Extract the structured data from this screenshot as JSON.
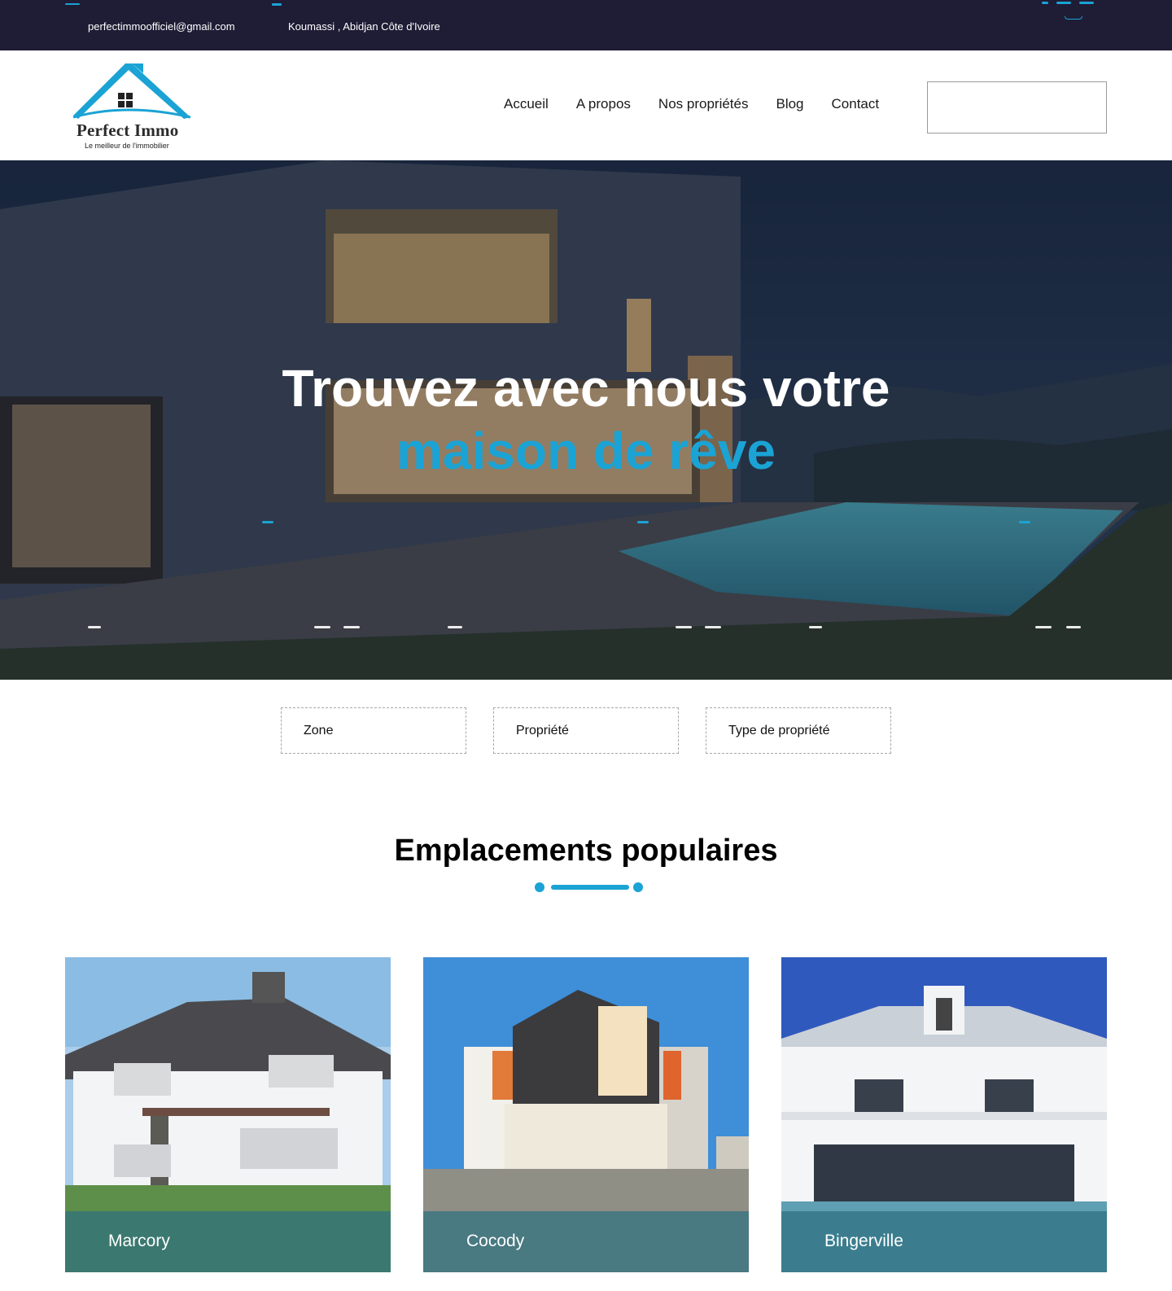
{
  "topbar": {
    "email": "perfectimmoofficiel@gmail.com",
    "address": "Koumassi , Abidjan Côte d'Ivoire"
  },
  "header": {
    "logo": {
      "brand": "Perfect Immo",
      "tagline": "Le meilleur de l'immobilier"
    },
    "nav": [
      "Accueil",
      "A propos",
      "Nos propriétés",
      "Blog",
      "Contact"
    ],
    "search_placeholder": ""
  },
  "hero": {
    "title_line1": "Trouvez avec nous votre",
    "title_line2": "maison de rêve"
  },
  "filters": [
    "Zone",
    "Propriété",
    "Type de propriété"
  ],
  "popular": {
    "title": "Emplacements populaires",
    "locations": [
      "Marcory",
      "Cocody",
      "Bingerville"
    ]
  },
  "colors": {
    "accent": "#1aa3d4",
    "topbar_bg": "#1f1c35",
    "text_dark": "#000000",
    "card_band": "#2e7080"
  },
  "icons": [
    "house-logo-icon",
    "facebook-icon",
    "instagram-icon",
    "twitter-icon",
    "search-icon"
  ]
}
